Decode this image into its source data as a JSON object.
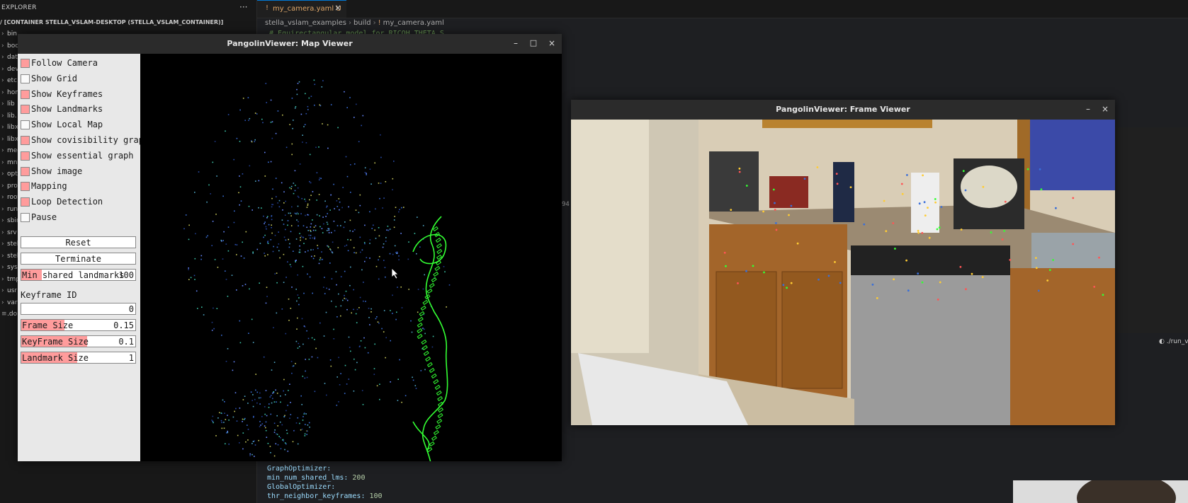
{
  "explorer": {
    "title": "EXPLORER",
    "more": "···",
    "container_title": "/ [CONTAINER STELLA_VSLAM-DESKTOP (STELLA_VSLAM_CONTAINER)]",
    "items": [
      "bin",
      "boo",
      "dat",
      "dev",
      "etc",
      "hom",
      "lib",
      "lib.",
      "libx",
      "libx",
      "med",
      "mnt",
      "opt",
      "proc",
      "root",
      "run",
      "sbin",
      "srv",
      "stel",
      "stel",
      "sys",
      "tmp",
      "usr",
      "var",
      ".do"
    ]
  },
  "tab": {
    "icon": "!",
    "label": "my_camera.yaml U",
    "close": "×"
  },
  "breadcrumb": {
    "parts": [
      "stella_vslam_examples",
      "build",
      "my_camera.yaml"
    ]
  },
  "editor": {
    "top_line": "# Equirectangular model for RICOH THETA S",
    "stray": "94",
    "code": [
      {
        "key": "GraphOptimizer:",
        "val": ""
      },
      {
        "key": "  min_num_shared_lms:",
        "val": " 200"
      },
      {
        "key": "GlobalOptimizer:",
        "val": ""
      },
      {
        "key": "  thr_neighbor_keyframes:",
        "val": " 100"
      }
    ]
  },
  "terminal_tab": "./run_v",
  "map_viewer": {
    "title": "PangolinViewer: Map Viewer",
    "controls": {
      "minimize": "–",
      "maximize": "□",
      "close": "×"
    },
    "checkboxes": [
      {
        "label": "Follow Camera",
        "checked": true
      },
      {
        "label": "Show Grid",
        "checked": false
      },
      {
        "label": "Show Keyframes",
        "checked": true
      },
      {
        "label": "Show Landmarks",
        "checked": true
      },
      {
        "label": "Show Local Map",
        "checked": false
      },
      {
        "label": "Show covisibility graph",
        "checked": true
      },
      {
        "label": "Show essential graph",
        "checked": true
      },
      {
        "label": "Show image",
        "checked": true
      },
      {
        "label": "Mapping",
        "checked": true
      },
      {
        "label": "Loop Detection",
        "checked": true
      },
      {
        "label": "Pause",
        "checked": false
      }
    ],
    "buttons": {
      "reset": "Reset",
      "terminate": "Terminate"
    },
    "min_shared": {
      "label": "Min shared landmarks",
      "value": "100",
      "fill": 0.18
    },
    "keyframe_id": {
      "label": "Keyframe ID",
      "value": "0"
    },
    "frame_size": {
      "label": "Frame Size",
      "value": "0.15",
      "fill": 0.38
    },
    "keyframe_size": {
      "label": "KeyFrame Size",
      "value": "0.1",
      "fill": 0.58
    },
    "landmark_size": {
      "label": "Landmark Size",
      "value": "1",
      "fill": 0.49
    }
  },
  "frame_viewer": {
    "title": "PangolinViewer: Frame Viewer",
    "controls": {
      "minimize": "–",
      "close": "×"
    }
  },
  "colors": {
    "checked": "#ff9c9c",
    "trajectory": "#33ff33",
    "landmark_blue": "#3a6fd8"
  }
}
